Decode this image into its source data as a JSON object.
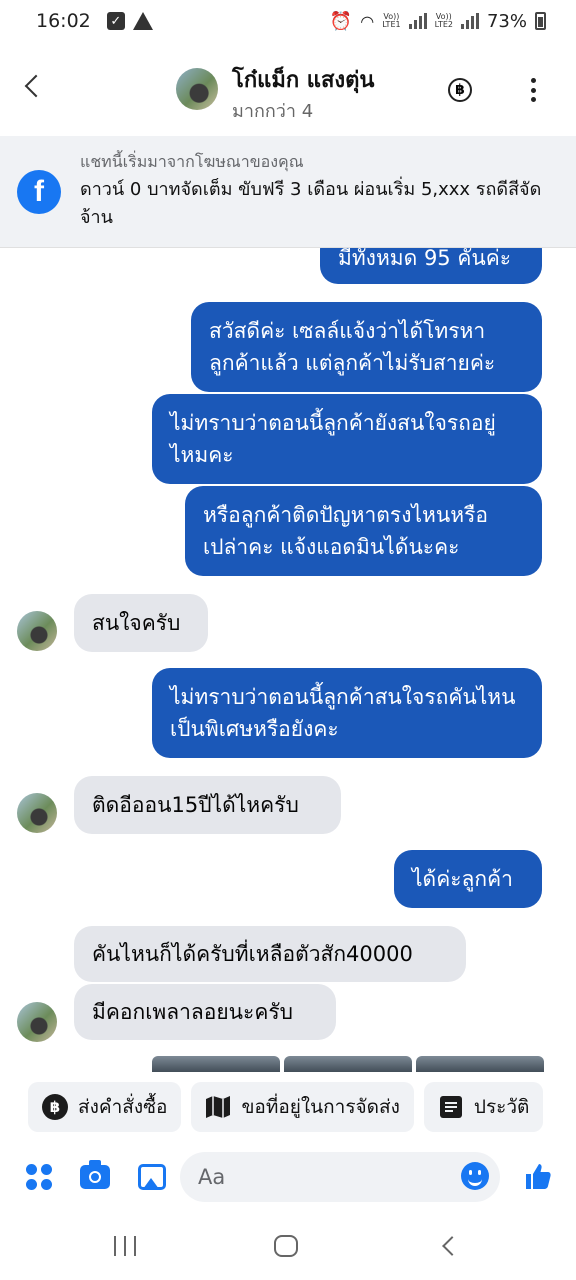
{
  "status_bar": {
    "time": "16:02",
    "battery": "73%",
    "sim1": {
      "label_top": "Vo))",
      "label_bottom": "LTE1"
    },
    "sim2": {
      "label_top": "Vo))",
      "label_bottom": "LTE2"
    }
  },
  "header": {
    "name": "โก๋แม็ก แสงตุ่น",
    "subtitle": "มากกว่า 4"
  },
  "ad_banner": {
    "title": "แชทนี้เริ่มมาจากโฆษณาของคุณ",
    "text": "ดาวน์ 0 บาทจัดเต็ม ขับฟรี 3 เดือน ผ่อนเริ่ม 5,xxx รถดีสีจัดจ้าน"
  },
  "messages": [
    {
      "from": "me",
      "text": "มีทั้งหมด 95 คันค่ะ"
    },
    {
      "from": "me",
      "text": "สวัสดีค่ะ เซลล์แจ้งว่าได้โทรหาลูกค้าแล้ว แต่ลูกค้าไม่รับสายค่ะ"
    },
    {
      "from": "me",
      "text": "ไม่ทราบว่าตอนนี้ลูกค้ายังสนใจรถอยู่ไหมคะ"
    },
    {
      "from": "me",
      "text": "หรือลูกค้าติดปัญหาตรงไหนหรือเปล่าคะ แจ้งแอดมินได้นะคะ"
    },
    {
      "from": "them",
      "text": "สนใจครับ"
    },
    {
      "from": "me",
      "text": "ไม่ทราบว่าตอนนี้ลูกค้าสนใจรถคันไหนเป็นพิเศษหรือยังคะ"
    },
    {
      "from": "them",
      "text": "ติดอีออน15ปีได้ไหครับ"
    },
    {
      "from": "me",
      "text": "ได้ค่ะลูกค้า"
    },
    {
      "from": "them",
      "text": "คันไหนก็ได้ครับที่เหลือตัวสัก40000"
    },
    {
      "from": "them",
      "text": "มีคอกเพลาลอยนะครับ"
    }
  ],
  "quick_actions": [
    {
      "label": "ส่งคำสั่งซื้อ",
      "icon": "baht-icon"
    },
    {
      "label": "ขอที่อยู่ในการจัดส่ง",
      "icon": "map-icon"
    },
    {
      "label": "ประวัติ",
      "icon": "document-icon"
    }
  ],
  "composer": {
    "placeholder": "Aa"
  },
  "colors": {
    "outgoing_bubble": "#1b58b8",
    "incoming_bubble": "#e4e6eb",
    "accent": "#1877f2"
  }
}
